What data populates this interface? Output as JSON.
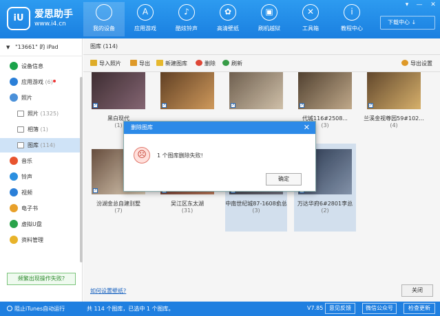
{
  "app": {
    "brand_title": "爱思助手",
    "brand_url": "www.i4.cn",
    "brand_mark": "iU"
  },
  "nav": [
    {
      "label": "我的设备",
      "icon": "apple-icon",
      "glyph": "",
      "active": true
    },
    {
      "label": "应用游戏",
      "icon": "app-store-icon",
      "glyph": "A"
    },
    {
      "label": "酷炫铃声",
      "icon": "bell-icon",
      "glyph": "♪"
    },
    {
      "label": "高清壁纸",
      "icon": "flower-icon",
      "glyph": "✿"
    },
    {
      "label": "刷机越狱",
      "icon": "box-icon",
      "glyph": "▣"
    },
    {
      "label": "工具箱",
      "icon": "tools-icon",
      "glyph": "✕"
    },
    {
      "label": "教程中心",
      "icon": "info-icon",
      "glyph": "i"
    }
  ],
  "window_controls": {
    "dropdown": "▾",
    "minimize": "—",
    "close": "✕"
  },
  "download_center": "下载中心 ↓",
  "device": {
    "label": "\"13661\" 的 iPad"
  },
  "sidebar": {
    "items": [
      {
        "label": "设备信息",
        "icon": "info-icon",
        "color": "#1aa34a"
      },
      {
        "label": "应用游戏",
        "count": "(6)",
        "icon": "app-icon",
        "color": "#2a7fd8",
        "dot": true
      },
      {
        "label": "照片",
        "icon": "photo-icon",
        "color": "#4a90d9"
      },
      {
        "label": "照片",
        "count": "(1325)",
        "icon": "folder-icon",
        "sub": true
      },
      {
        "label": "相簿",
        "count": "(1)",
        "icon": "folder-icon",
        "sub": true
      },
      {
        "label": "图库",
        "count": "(114)",
        "icon": "folder-icon",
        "sub": true,
        "selected": true
      },
      {
        "label": "音乐",
        "icon": "music-icon",
        "color": "#e8542e"
      },
      {
        "label": "铃声",
        "icon": "bell-icon",
        "color": "#2a8fe0"
      },
      {
        "label": "视频",
        "icon": "video-icon",
        "color": "#2a7fd8"
      },
      {
        "label": "电子书",
        "icon": "book-icon",
        "color": "#e8a02a"
      },
      {
        "label": "虚拟U盘",
        "icon": "usb-icon",
        "color": "#2aa34a"
      },
      {
        "label": "资料管理",
        "icon": "file-icon",
        "color": "#e8b32a"
      }
    ],
    "fix_button": "频繁出现操作失败?"
  },
  "breadcrumb": "图库 (114)",
  "toolbar": {
    "import": "导入照片",
    "export": "导出",
    "new_library": "新建图库",
    "delete": "删除",
    "refresh": "刷新",
    "export_settings": "导出设置"
  },
  "tiles_row1": [
    {
      "name": "黑白现代",
      "count": "(1)",
      "colors": [
        "#3a2a2e",
        "#8a6a78"
      ]
    },
    {
      "name": "",
      "count": "",
      "colors": [
        "#5a3a20",
        "#d8a060"
      ]
    },
    {
      "name": "",
      "count": "",
      "colors": [
        "#6a5a4a",
        "#d8c8b0"
      ]
    },
    {
      "name": "代城116#2508...",
      "count": "(3)",
      "colors": [
        "#4a3a2a",
        "#c8b090"
      ]
    },
    {
      "name": "兰溪金视尊园59#102...",
      "count": "(4)",
      "colors": [
        "#5a4028",
        "#e0b870"
      ]
    }
  ],
  "tiles_row2": [
    {
      "name": "汾湖金总自建别墅",
      "count": "(7)",
      "colors": [
        "#6a5040",
        "#e8d8c0"
      ]
    },
    {
      "name": "吴江区东太湖",
      "count": "(31)",
      "colors": [
        "#4a2020",
        "#c88060"
      ]
    },
    {
      "name": "中南世纪城87-1608俞总",
      "count": "(3)",
      "colors": [
        "#2a2a30",
        "#7a7a88"
      ],
      "selected": true
    },
    {
      "name": "万达华府6#2801李总",
      "count": "(2)",
      "colors": [
        "#2a3850",
        "#8898b0"
      ],
      "selected": true
    }
  ],
  "footer": {
    "link": "如何设置壁纸?",
    "close": "关闭"
  },
  "statusbar": {
    "itunes": "阻止iTunes自动运行",
    "summary": "共 114 个图库，已选中 1 个图库。",
    "version": "V7.85",
    "feedback": "意见反馈",
    "wechat": "微信公众号",
    "update": "检查更新"
  },
  "dialog": {
    "title": "删除图库",
    "message": "1 个图库删除失败!",
    "ok": "确定",
    "close_glyph": "✕",
    "face_glyph": "☹"
  }
}
